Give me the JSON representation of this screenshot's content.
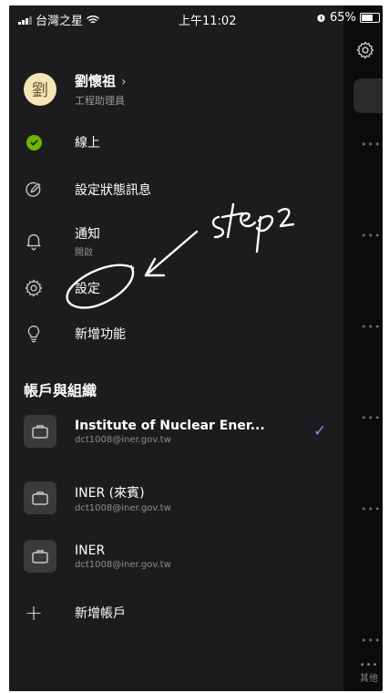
{
  "status_bar": {
    "carrier": "台灣之星",
    "time": "上午11:02",
    "battery": "65%"
  },
  "profile": {
    "avatar_char": "劉",
    "name": "劉懷祖",
    "chevron": "›",
    "role": "工程助理員"
  },
  "menu": {
    "presence": {
      "label": "線上",
      "icon": "check-circle-icon",
      "color": "#6bb700"
    },
    "status_message": {
      "label": "設定狀態訊息",
      "icon": "pencil-circle-icon"
    },
    "notifications": {
      "label": "通知",
      "sub": "開啟",
      "icon": "bell-icon"
    },
    "settings": {
      "label": "設定",
      "icon": "gear-icon"
    },
    "whats_new": {
      "label": "新增功能",
      "icon": "lightbulb-icon"
    }
  },
  "accounts": {
    "title": "帳戶與組織",
    "items": [
      {
        "name": "Institute of Nuclear Ener...",
        "email": "dct1008@iner.gov.tw",
        "selected": true
      },
      {
        "name": "INER (來賓)",
        "email": "dct1008@iner.gov.tw",
        "selected": false
      },
      {
        "name": "INER",
        "email": "dct1008@iner.gov.tw",
        "selected": false
      }
    ],
    "check_mark": "✓",
    "add_label": "新增帳戶",
    "add_symbol": "+"
  },
  "background": {
    "dots": "•••",
    "other_label": "其他"
  },
  "annotation": {
    "text": "step 2"
  },
  "colors": {
    "drawer_bg": "#1c1c1e",
    "accent": "#8b8cf0",
    "presence_green": "#6bb700"
  }
}
